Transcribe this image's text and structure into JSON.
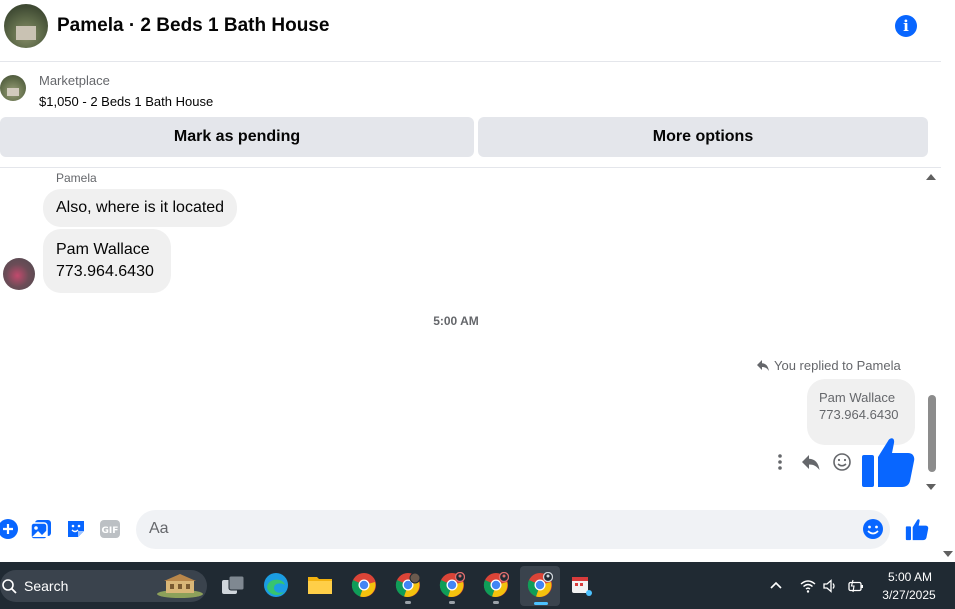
{
  "header": {
    "title": "Pamela · 2 Beds 1 Bath House",
    "info_icon": "info-icon",
    "accent": "#0866ff"
  },
  "marketplace": {
    "label": "Marketplace",
    "listing": "$1,050 - 2 Beds 1 Bath House",
    "mark_pending": "Mark as pending",
    "more_options": "More options"
  },
  "conversation": {
    "sender_name": "Pamela",
    "messages": [
      {
        "text": "Also, where is it located"
      },
      {
        "line1": "Pam Wallace",
        "line2": "773.964.6430"
      }
    ],
    "time_separator": "5:00 AM",
    "reply_notice": "You replied to Pamela",
    "my_reply": {
      "line1": "Pam Wallace",
      "line2": "773.964.6430"
    },
    "sent_reaction": "thumbs-up-icon"
  },
  "composer": {
    "placeholder": "Aa"
  },
  "taskbar": {
    "search_label": "Search",
    "apps": [
      "task-view-icon",
      "edge-icon",
      "file-explorer-icon",
      "chrome-icon",
      "chrome-profile-icon",
      "chrome-profile-icon",
      "chrome-profile-icon",
      "chrome-profile-icon",
      "snipping-tool-icon"
    ],
    "clock_time": "5:00 AM",
    "clock_date": "3/27/2025"
  }
}
